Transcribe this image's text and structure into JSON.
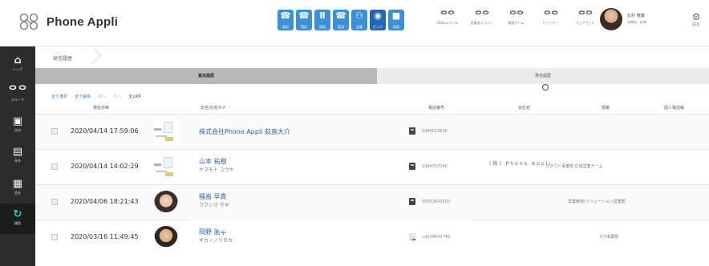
{
  "header": {
    "logo_text": "Phone Appli",
    "tools": [
      {
        "icon": "phone-icon",
        "glyph": "☎",
        "label": "発信",
        "active": false
      },
      {
        "icon": "phone-in-icon",
        "glyph": "☎",
        "label": "受信",
        "active": false
      },
      {
        "icon": "pause-icon",
        "glyph": "Ⅱ",
        "label": "保留",
        "active": false
      },
      {
        "icon": "transfer-icon",
        "glyph": "☎",
        "label": "転送",
        "active": false
      },
      {
        "icon": "conference-icon",
        "glyph": "⚇",
        "label": "会議",
        "active": false
      },
      {
        "icon": "pickup-icon",
        "glyph": "◉",
        "label": "ピック",
        "active": true
      },
      {
        "icon": "end-call-icon",
        "glyph": "■",
        "label": "終話",
        "active": false
      }
    ],
    "groups": [
      {
        "label": "CRE&エチーム",
        "glyph": "ᄋᄋ"
      },
      {
        "label": "営業部メンバー",
        "glyph": "ᄋᄋ"
      },
      {
        "label": "開発チーム",
        "glyph": "ᄋᄋ"
      },
      {
        "label": "パートナー",
        "glyph": "ᄋᄋ"
      },
      {
        "label": "フェアウェル",
        "glyph": "ᄋᄋ"
      }
    ],
    "user": {
      "name": "北村 竜博",
      "status": "在席在 : 在席"
    },
    "settings_label": "設定"
  },
  "sidebar": {
    "items": [
      {
        "glyph": "⌂",
        "label": "トップ",
        "active": false
      },
      {
        "glyph": "ᄋᄋ",
        "label": "グループ",
        "active": false
      },
      {
        "glyph": "▣",
        "label": "社内",
        "active": false
      },
      {
        "glyph": "▤",
        "label": "社外",
        "active": false
      },
      {
        "glyph": "▦",
        "label": "会社",
        "active": false
      },
      {
        "glyph": "↻",
        "label": "履歴",
        "active": true
      }
    ]
  },
  "main": {
    "breadcrumb": "発信履歴",
    "tabs": {
      "incoming": "着信履歴",
      "outgoing": "発信履歴"
    },
    "toolbar": {
      "select_all": "全て選択",
      "clear_all": "全て解除",
      "prev": "前へ",
      "next": "次へ",
      "count": "全24件"
    },
    "columns": {
      "date": "発信日時",
      "name": "氏名/氏名カナ",
      "phone": "電話番号",
      "company": "会社名",
      "dept": "部署",
      "personal": "個人電話帳"
    },
    "rows": [
      {
        "date": "2020/04/14 17:59:06",
        "thumb": "card",
        "name": "株式会社Phone Appli 荻島大介",
        "kana": "",
        "phone": "0384023836",
        "company": "",
        "company_kana": "",
        "dept": ""
      },
      {
        "date": "2020/04/14 14:02:29",
        "thumb": "card",
        "name": "山本 祐樹",
        "kana": "ヤマモト ユウキ",
        "phone": "0384557046",
        "company": "(株) Phone Appli",
        "company_kana": "",
        "dept": "クラウド事業部 広域営業チーム"
      },
      {
        "date": "2020/04/06 18:21:43",
        "thumb": "photo1",
        "name": "福島 早貴",
        "kana": "フクシマ サキ",
        "phone": "05053643500",
        "company": "",
        "company_kana": "",
        "dept": "営業統括/ソリューション営業部"
      },
      {
        "date": "2020/03/16 11:49:45",
        "thumb": "photo2",
        "name": "岡野 憲孝",
        "kana": "オカノノリタカ",
        "phone": "09039043748",
        "company": "",
        "company_kana": "",
        "dept": "ICT事業部"
      }
    ]
  }
}
